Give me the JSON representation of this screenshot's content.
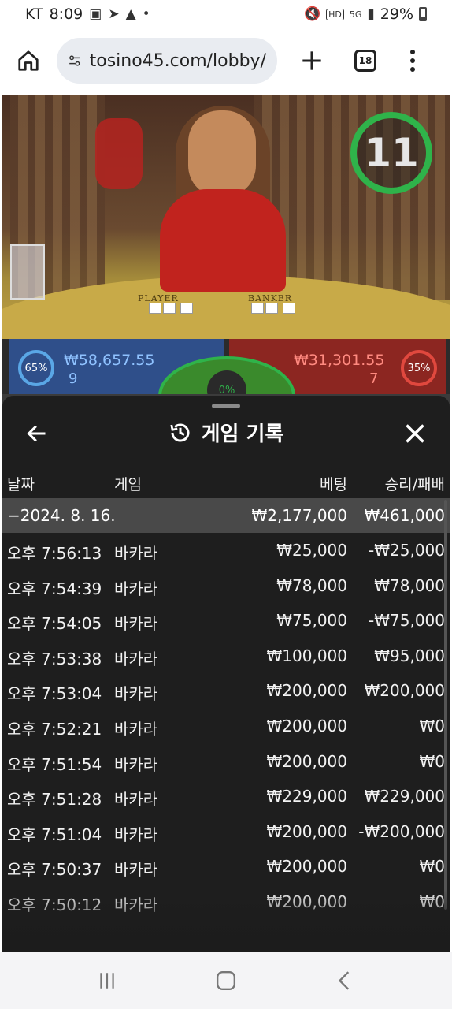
{
  "status": {
    "carrier": "KT",
    "time": "8:09",
    "battery": "29%",
    "network": "5G"
  },
  "browser": {
    "url": "tosino45.com/lobby/",
    "tab_count": "18"
  },
  "game": {
    "timer": "11",
    "player_pct": "65%",
    "player_amount": "₩58,657.55",
    "player_count": "9",
    "banker_pct": "35%",
    "banker_amount": "₩31,301.55",
    "banker_count": "7",
    "table_player": "PLAYER",
    "table_banker": "BANKER",
    "center_pct": "0%"
  },
  "modal": {
    "title": "게임 기록",
    "columns": {
      "date": "날짜",
      "game": "게임",
      "bet": "베팅",
      "winloss": "승리/패배"
    },
    "summary": {
      "date": "−2024. 8. 16.",
      "bet": "₩2,177,000",
      "winloss": "₩461,000"
    },
    "rows": [
      {
        "time": "오후 7:56:13",
        "game": "바카라",
        "bet": "₩25,000",
        "winloss": "-₩25,000"
      },
      {
        "time": "오후 7:54:39",
        "game": "바카라",
        "bet": "₩78,000",
        "winloss": "₩78,000"
      },
      {
        "time": "오후 7:54:05",
        "game": "바카라",
        "bet": "₩75,000",
        "winloss": "-₩75,000"
      },
      {
        "time": "오후 7:53:38",
        "game": "바카라",
        "bet": "₩100,000",
        "winloss": "₩95,000"
      },
      {
        "time": "오후 7:53:04",
        "game": "바카라",
        "bet": "₩200,000",
        "winloss": "₩200,000"
      },
      {
        "time": "오후 7:52:21",
        "game": "바카라",
        "bet": "₩200,000",
        "winloss": "₩0"
      },
      {
        "time": "오후 7:51:54",
        "game": "바카라",
        "bet": "₩200,000",
        "winloss": "₩0"
      },
      {
        "time": "오후 7:51:28",
        "game": "바카라",
        "bet": "₩229,000",
        "winloss": "₩229,000"
      },
      {
        "time": "오후 7:51:04",
        "game": "바카라",
        "bet": "₩200,000",
        "winloss": "-₩200,000"
      },
      {
        "time": "오후 7:50:37",
        "game": "바카라",
        "bet": "₩200,000",
        "winloss": "₩0"
      },
      {
        "time": "오후 7:50:12",
        "game": "바카라",
        "bet": "₩200,000",
        "winloss": "₩0"
      }
    ]
  },
  "colors": {
    "timer_ring": "#2fb34a",
    "player_panel": "#2f4f8a",
    "banker_panel": "#8c2621",
    "modal_bg": "#1c1c1c"
  }
}
